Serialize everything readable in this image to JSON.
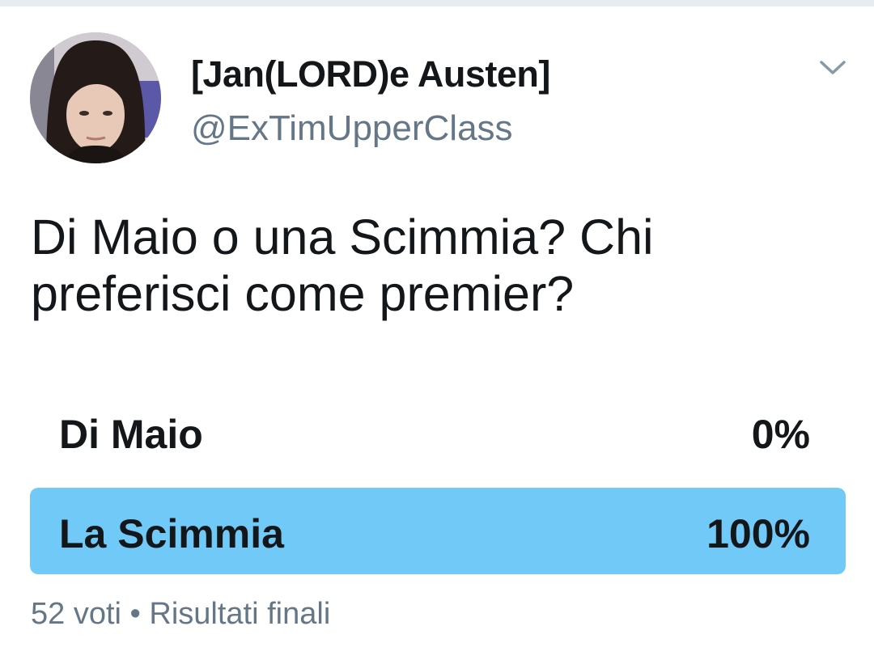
{
  "tweet": {
    "author": {
      "display_name": "[Jan(LORD)e Austen]",
      "handle": "@ExTimUpperClass"
    },
    "text_line1": "Di Maio o una Scimmia? Chi",
    "text_line2": "preferisci come premier?",
    "menu_icon": "chevron-down-icon"
  },
  "poll": {
    "options": [
      {
        "label": "Di Maio",
        "percent_text": "0%",
        "fraction": 0.0
      },
      {
        "label": "La Scimmia",
        "percent_text": "100%",
        "fraction": 1.0
      }
    ],
    "votes": "52 voti",
    "separator": "•",
    "status": "Risultati finali"
  },
  "colors": {
    "winner_bar": "#71c9f8",
    "secondary_text": "#657786",
    "primary_text": "#14171a"
  }
}
